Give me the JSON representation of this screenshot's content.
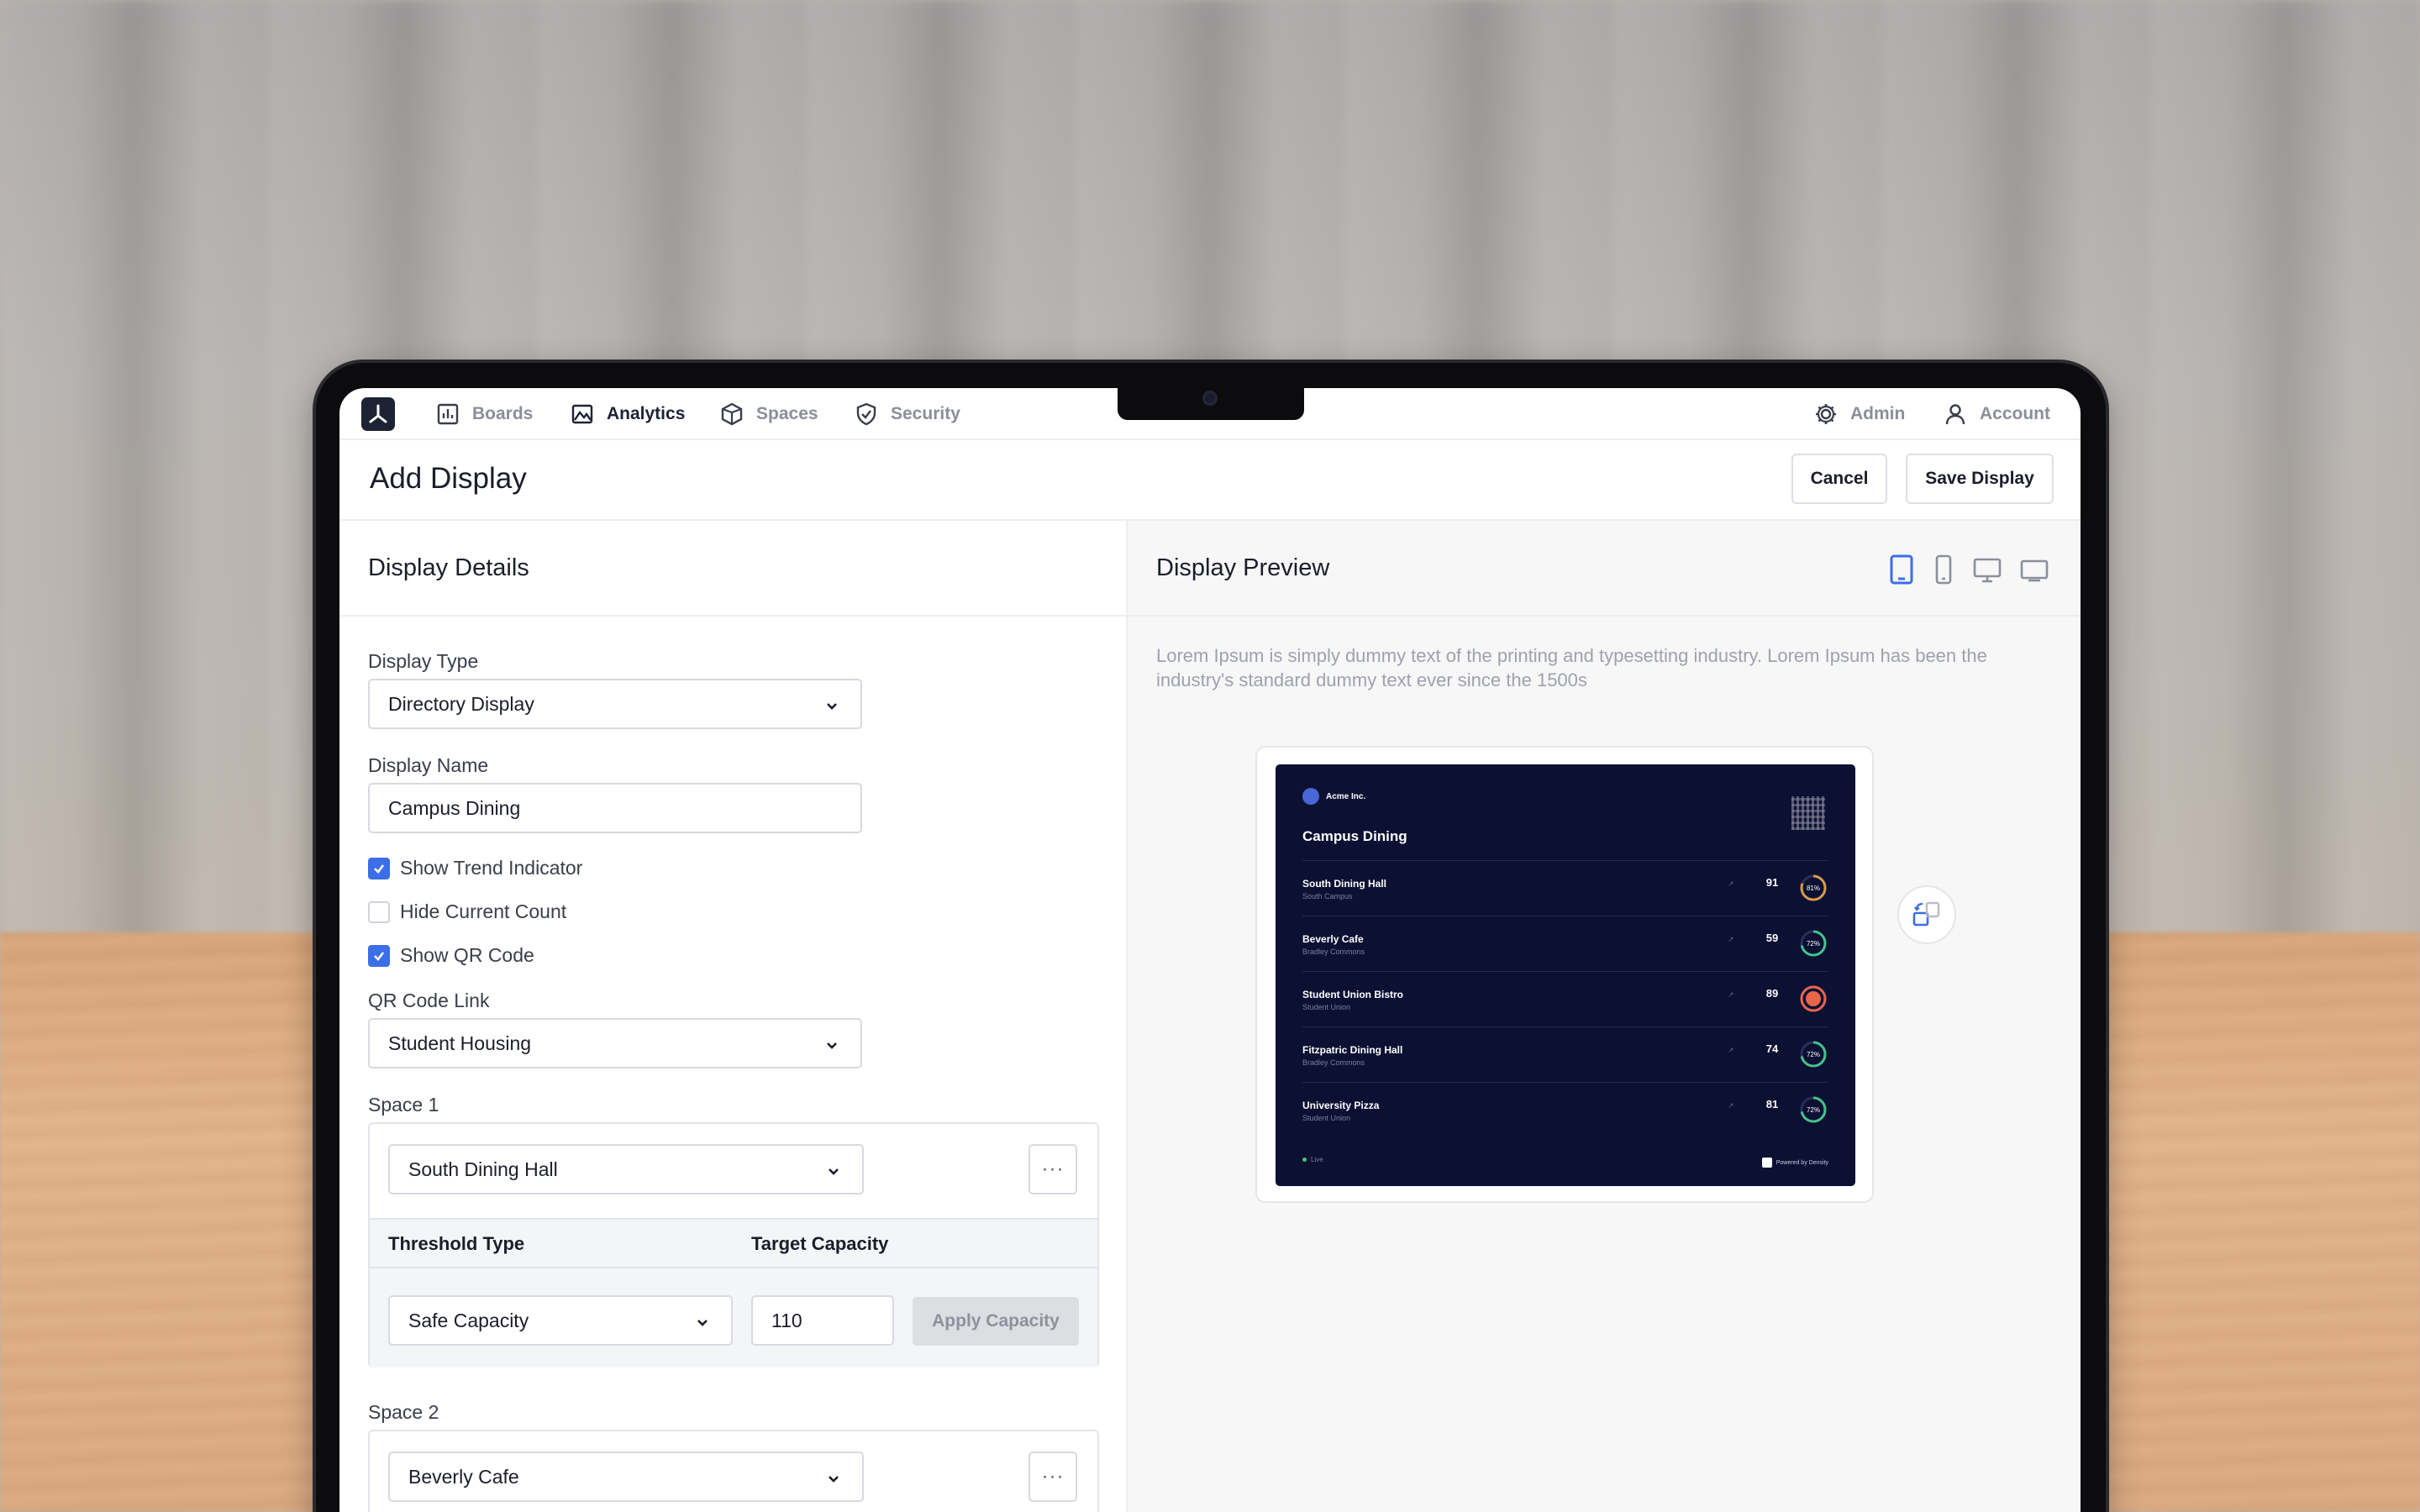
{
  "nav": {
    "items": [
      {
        "label": "Boards",
        "icon": "bar-chart-icon",
        "active": false
      },
      {
        "label": "Analytics",
        "icon": "image-chart-icon",
        "active": true
      },
      {
        "label": "Spaces",
        "icon": "cube-icon",
        "active": false
      },
      {
        "label": "Security",
        "icon": "shield-check-icon",
        "active": false
      }
    ],
    "admin": "Admin",
    "account": "Account"
  },
  "header": {
    "title": "Add Display",
    "cancel": "Cancel",
    "save": "Save Display"
  },
  "details": {
    "title": "Display Details",
    "display_type_label": "Display Type",
    "display_type_value": "Directory Display",
    "display_name_label": "Display Name",
    "display_name_value": "Campus Dining",
    "show_trend": {
      "label": "Show Trend Indicator",
      "checked": true
    },
    "hide_count": {
      "label": "Hide Current Count",
      "checked": false
    },
    "show_qr": {
      "label": "Show QR Code",
      "checked": true
    },
    "qr_link_label": "QR Code Link",
    "qr_link_value": "Student Housing",
    "space1": {
      "label": "Space 1",
      "value": "South Dining Hall",
      "more": "···",
      "threshold_type_label": "Threshold Type",
      "target_capacity_label": "Target Capacity",
      "threshold_type_value": "Safe Capacity",
      "target_capacity_value": "110",
      "apply": "Apply Capacity"
    },
    "space2": {
      "label": "Space 2",
      "value": "Beverly Cafe",
      "more": "···"
    }
  },
  "preview": {
    "title": "Display Preview",
    "description": "Lorem Ipsum is simply dummy text of the printing and typesetting industry. Lorem Ipsum has been the industry's standard dummy text ever since the 1500s",
    "device_icons": [
      "tablet-icon",
      "phone-icon",
      "desktop-icon",
      "tv-icon"
    ],
    "screen": {
      "brand": "Acme Inc.",
      "title": "Campus Dining",
      "rows": [
        {
          "name": "South Dining Hall",
          "sub": "South Campus",
          "count": "91",
          "ring_color": "#d99a4a",
          "pct": 0.81,
          "label": "81%"
        },
        {
          "name": "Beverly Cafe",
          "sub": "Bradley Commons",
          "count": "59",
          "ring_color": "#44c28a",
          "pct": 0.72,
          "label": "72%"
        },
        {
          "name": "Student Union Bistro",
          "sub": "Student Union",
          "count": "89",
          "ring_color": "#e8654a",
          "pct": 1.0,
          "label": ""
        },
        {
          "name": "Fitzpatric Dining Hall",
          "sub": "Bradley Commons",
          "count": "74",
          "ring_color": "#44c28a",
          "pct": 0.72,
          "label": "72%"
        },
        {
          "name": "University Pizza",
          "sub": "Student Union",
          "count": "81",
          "ring_color": "#44c28a",
          "pct": 0.72,
          "label": "72%"
        }
      ],
      "footer_left": "Live",
      "footer_right": "Powered by Density"
    }
  }
}
